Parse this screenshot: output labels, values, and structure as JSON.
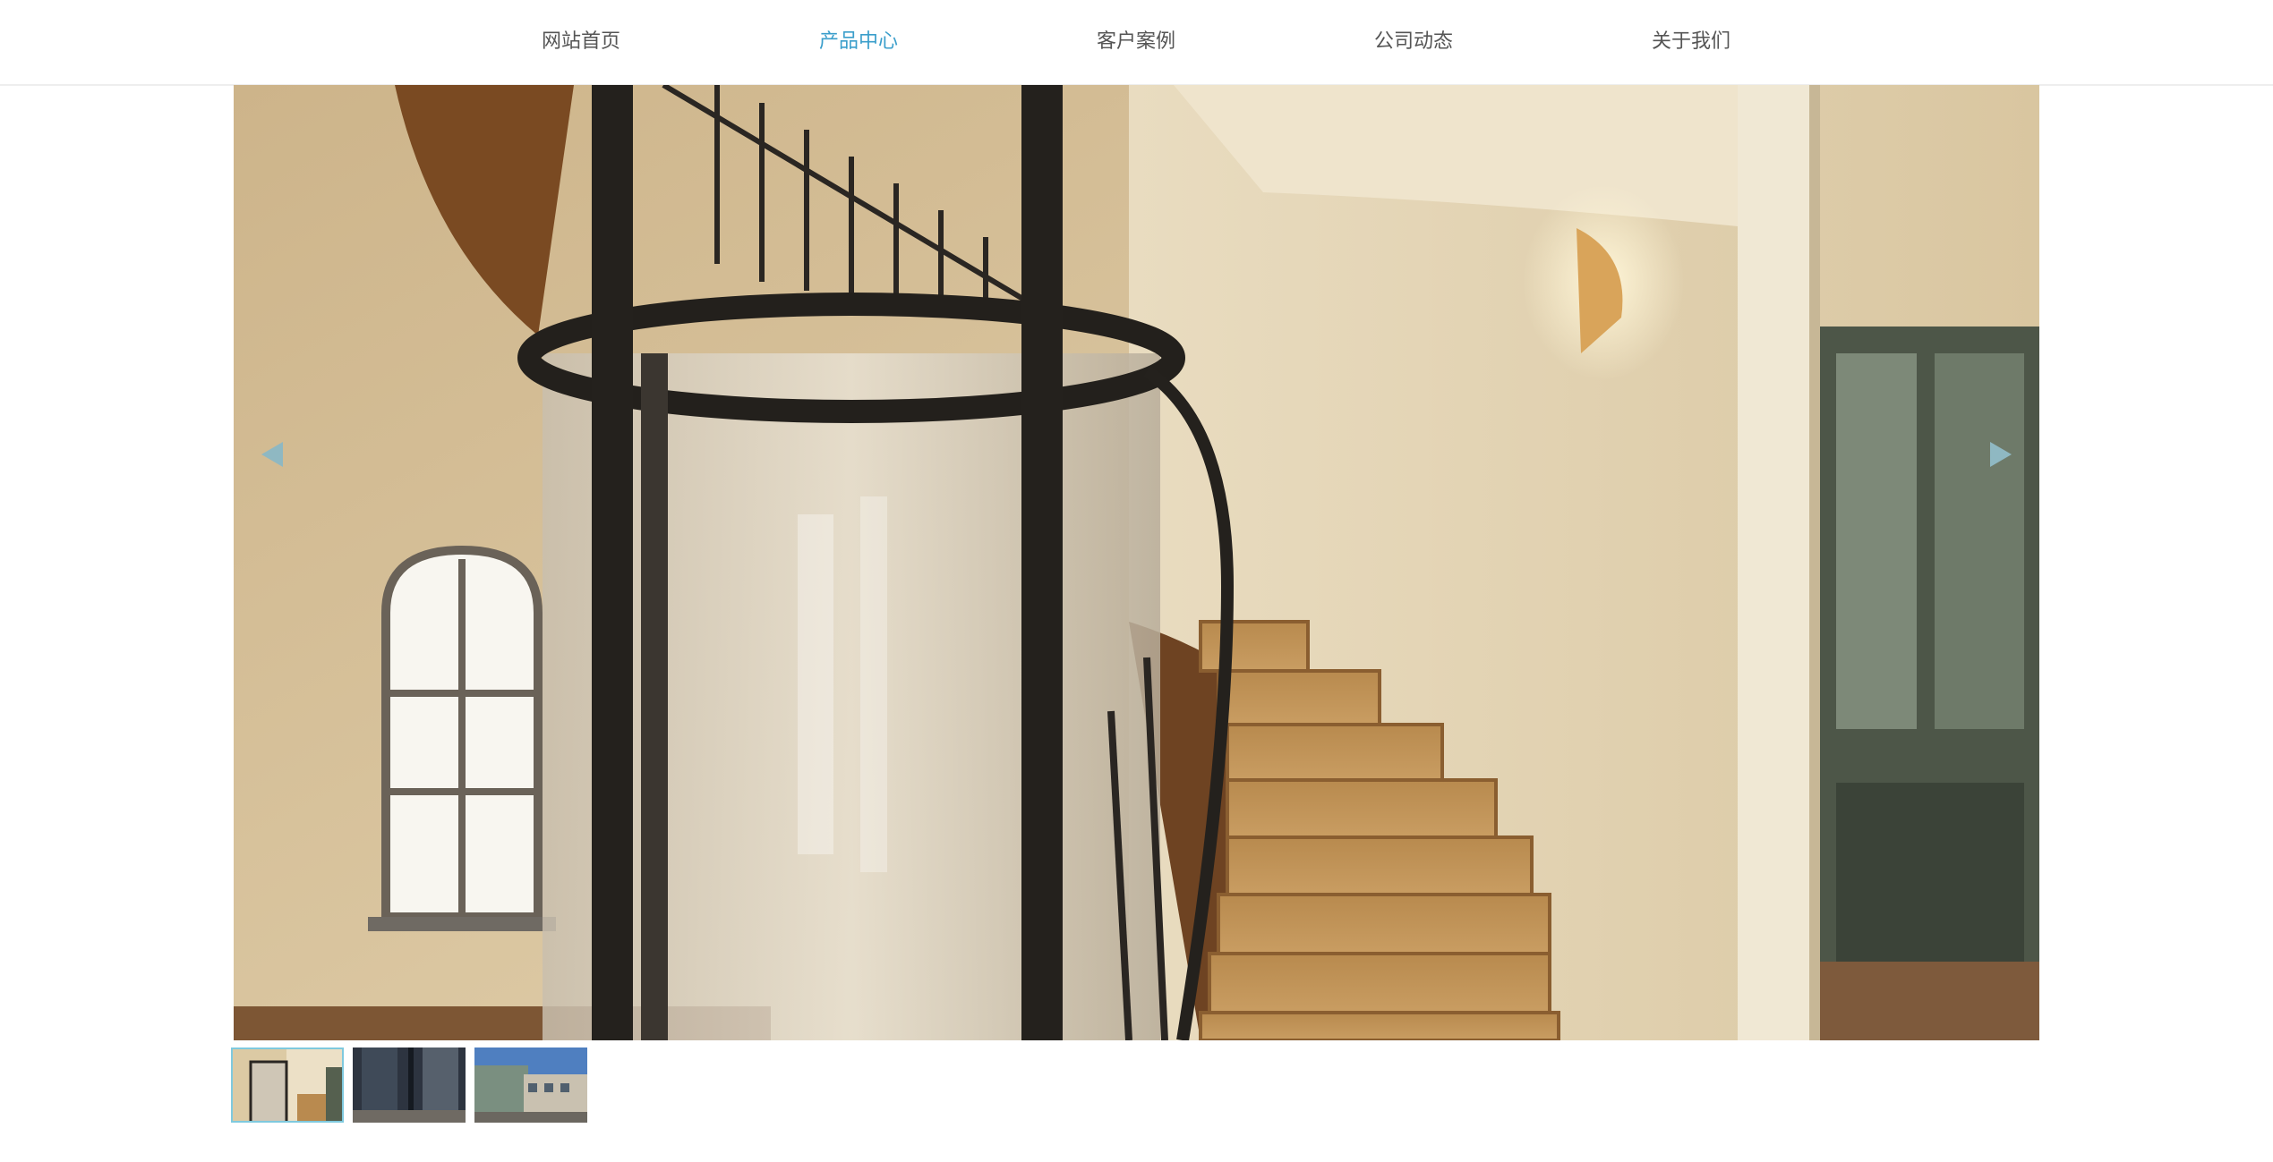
{
  "nav": {
    "items": [
      {
        "label": "网站首页",
        "active": false
      },
      {
        "label": "产品中心",
        "active": true
      },
      {
        "label": "客户案例",
        "active": false
      },
      {
        "label": "公司动态",
        "active": false
      },
      {
        "label": "关于我们",
        "active": false
      }
    ]
  },
  "slider": {
    "current_index": 1,
    "total": 3,
    "main_image": "glass-home-elevator-beside-curved-staircase",
    "prev_icon": "triangle-left-icon",
    "next_icon": "triangle-right-icon",
    "thumbnails": [
      {
        "image": "glass-elevator-staircase-thumbnail",
        "active": true
      },
      {
        "image": "dark-glass-entrance-thumbnail",
        "active": false
      },
      {
        "image": "building-exterior-blue-sky-thumbnail",
        "active": false
      }
    ]
  },
  "colors": {
    "accent": "#3a9ecb",
    "nav_text": "#555555",
    "arrow": "#8fb8c2",
    "thumb_border": "#7fc9de"
  }
}
